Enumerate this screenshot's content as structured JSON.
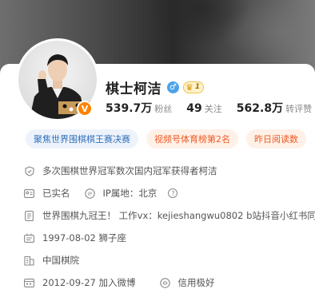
{
  "profile": {
    "name": "棋士柯洁",
    "gender_icon": "male-icon",
    "vip_level": "1",
    "verified_mark": "V"
  },
  "stats": [
    {
      "value": "539.7万",
      "label": "粉丝"
    },
    {
      "value": "49",
      "label": "关注"
    },
    {
      "value": "562.8万",
      "label": "转评赞"
    }
  ],
  "tags": [
    {
      "text": "聚焦世界围棋棋王赛决赛",
      "style": "blue"
    },
    {
      "text": "视频号体育榜第2名",
      "style": "orange"
    },
    {
      "text": "昨日阅读数",
      "style": "orange"
    }
  ],
  "info": {
    "certification": "多次围棋世界冠军数次国内冠军获得者柯洁",
    "real_name": "已实名",
    "ip_prefix": "IP属地：",
    "ip_location": "北京",
    "bio": "世界围棋九冠王！ 工作vx：kejieshangwu0802 b站抖音小红书同",
    "birthday": "1997-08-02 狮子座",
    "company": "中国棋院",
    "joined": "2012-09-27 加入微博",
    "credit": "信用极好"
  },
  "colors": {
    "accent_orange": "#ff8200",
    "tag_blue_text": "#2f6fb8",
    "tag_orange_text": "#ee5a24",
    "gender_blue": "#4aa3e8"
  }
}
